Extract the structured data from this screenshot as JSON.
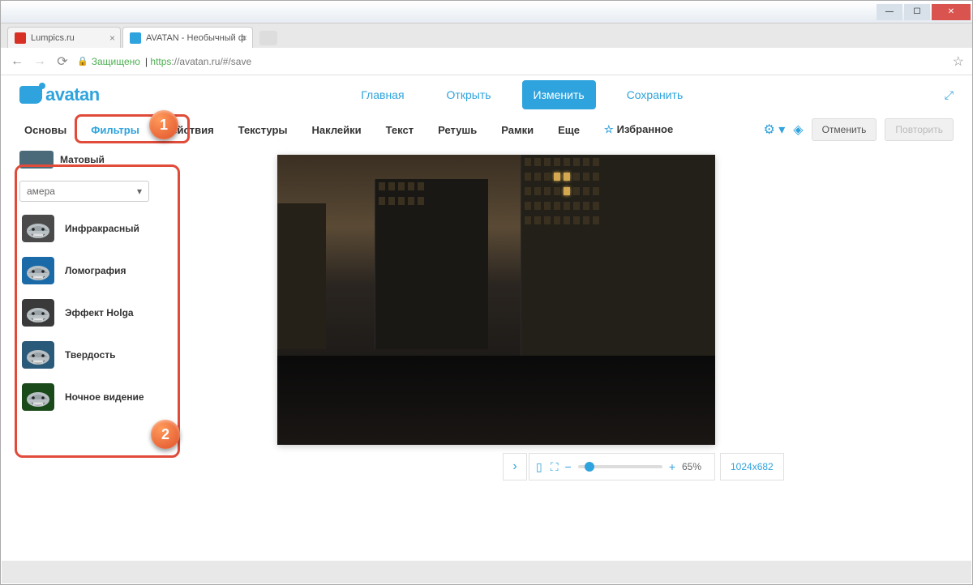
{
  "window": {
    "tabs": [
      {
        "label": "Lumpics.ru"
      },
      {
        "label": "AVATAN - Необычный ф"
      }
    ],
    "nav_back": "←",
    "nav_fwd": "→",
    "nav_reload": "⟳",
    "secure_label": "Защищено",
    "url_scheme": "https",
    "url_rest": "://avatan.ru/#/save"
  },
  "topnav": {
    "logo": "avatan",
    "links": {
      "home": "Главная",
      "open": "Открыть",
      "edit": "Изменить",
      "save": "Сохранить"
    }
  },
  "toolbar": {
    "basics": "Основы",
    "filters": "Фильтры",
    "actions": "Действия",
    "textures": "Текстуры",
    "stickers": "Наклейки",
    "text": "Текст",
    "retouch": "Ретушь",
    "frames": "Рамки",
    "more": "Еще",
    "favorites": "Избранное",
    "undo": "Отменить",
    "redo": "Повторить"
  },
  "sidebar": {
    "top_item": "Матовый",
    "category": "амера",
    "filters": [
      {
        "label": "Инфракрасный",
        "bg": "#4a4a4a"
      },
      {
        "label": "Ломография",
        "bg": "#1a6aa8"
      },
      {
        "label": "Эффект Holga",
        "bg": "#3a3a3a"
      },
      {
        "label": "Твердость",
        "bg": "#2a5a7a"
      },
      {
        "label": "Ночное видение",
        "bg": "#1a4a1a"
      }
    ]
  },
  "canvas": {
    "zoom": "65%",
    "dimensions": "1024x682"
  },
  "badges": {
    "one": "1",
    "two": "2"
  }
}
